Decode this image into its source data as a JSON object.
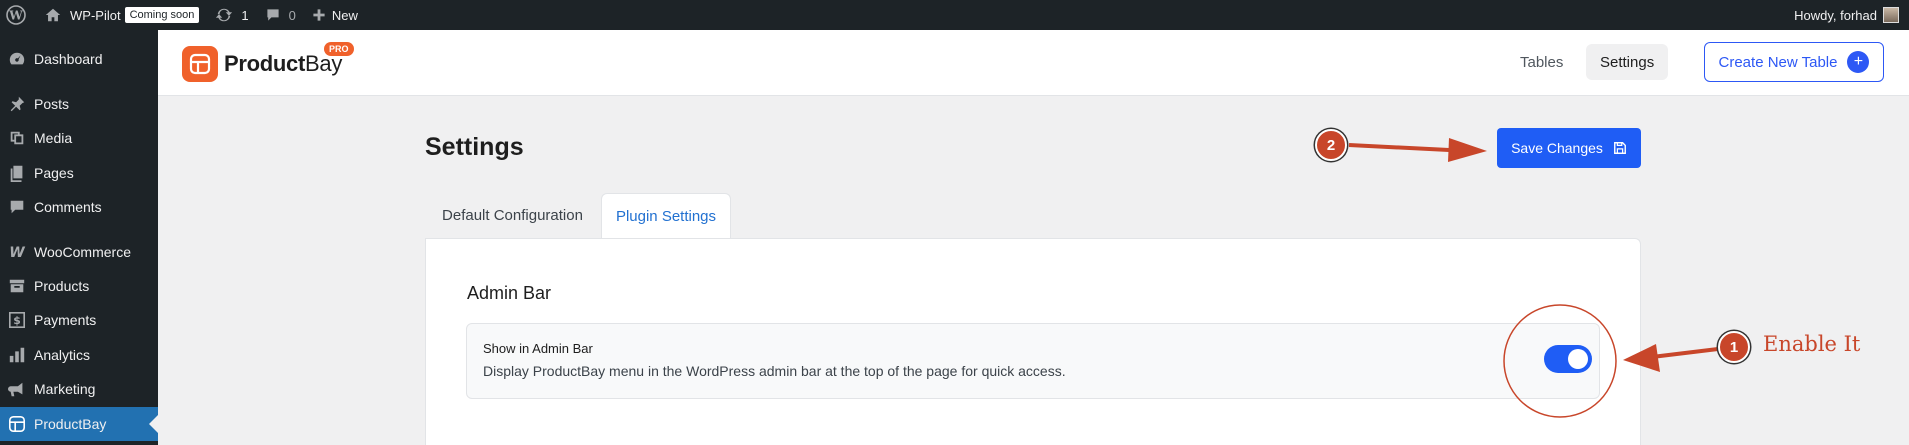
{
  "adminbar": {
    "site_name": "WP-Pilot",
    "coming_soon": "Coming soon",
    "updates_count": "1",
    "comments_count": "0",
    "new_label": "New",
    "greeting": "Howdy, forhad"
  },
  "sidebar": {
    "items": [
      {
        "label": "Dashboard",
        "icon": "dashboard-icon"
      },
      {
        "label": "Posts",
        "icon": "pin-icon"
      },
      {
        "label": "Media",
        "icon": "media-icon"
      },
      {
        "label": "Pages",
        "icon": "pages-icon"
      },
      {
        "label": "Comments",
        "icon": "comment-icon"
      },
      {
        "label": "WooCommerce",
        "icon": "woo-icon"
      },
      {
        "label": "Products",
        "icon": "archive-icon"
      },
      {
        "label": "Payments",
        "icon": "dollar-icon"
      },
      {
        "label": "Analytics",
        "icon": "chart-bar-icon"
      },
      {
        "label": "Marketing",
        "icon": "megaphone-icon"
      },
      {
        "label": "ProductBay",
        "icon": "productbay-icon",
        "active": true
      }
    ]
  },
  "header": {
    "logo_bold": "Product",
    "logo_light": "Bay",
    "pro_badge": "PRO",
    "nav": [
      "Tables",
      "Settings"
    ],
    "create_button": "Create New Table"
  },
  "page": {
    "title": "Settings",
    "save_button": "Save Changes",
    "tabs": [
      "Default Configuration",
      "Plugin Settings"
    ],
    "active_tab": "Plugin Settings"
  },
  "admin_bar_section": {
    "title": "Admin Bar",
    "setting_label": "Show in Admin Bar",
    "setting_desc": "Display ProductBay menu in the WordPress admin bar at the top of the page for quick access.",
    "toggle_on": true
  },
  "annotations": {
    "step1": "1",
    "step1_text": "Enable It",
    "step2": "2"
  },
  "colors": {
    "accent": "#1f5df5",
    "wp_dark": "#1d2327",
    "wp_blue": "#2271b1",
    "brand_orange": "#f0612b",
    "annotation": "#c8462a"
  }
}
